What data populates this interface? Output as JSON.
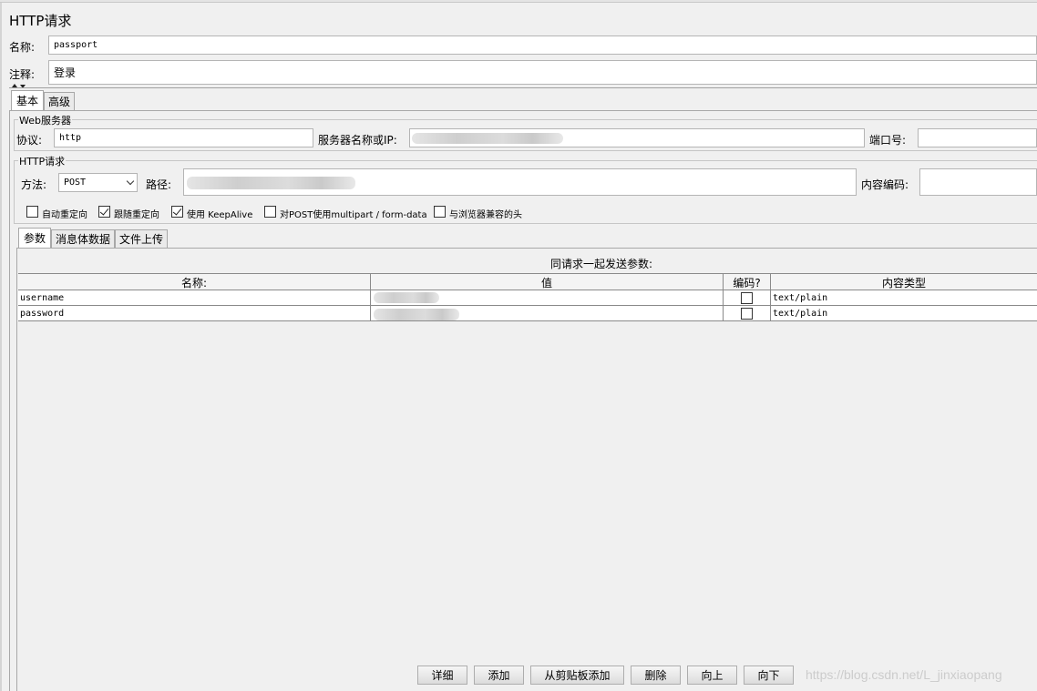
{
  "panel_title": "HTTP请求",
  "name_label": "名称:",
  "name_value": "passport",
  "comment_label": "注释:",
  "comment_value": "登录",
  "main_tabs": [
    {
      "label": "基本",
      "active": true
    },
    {
      "label": "高级",
      "active": false
    }
  ],
  "web_server": {
    "title": "Web服务器",
    "protocol_label": "协议:",
    "protocol_value": "http",
    "server_label": "服务器名称或IP:",
    "port_label": "端口号:"
  },
  "http_request": {
    "title": "HTTP请求",
    "method_label": "方法:",
    "method_value": "POST",
    "path_label": "路径:",
    "encoding_label": "内容编码:",
    "options": [
      {
        "label": "自动重定向",
        "checked": false
      },
      {
        "label": "跟随重定向",
        "checked": true
      },
      {
        "label": "使用 KeepAlive",
        "checked": true
      },
      {
        "label": "对POST使用multipart / form-data",
        "checked": false
      },
      {
        "label": "与浏览器兼容的头",
        "checked": false
      }
    ]
  },
  "param_tabs": [
    {
      "label": "参数",
      "active": true
    },
    {
      "label": "消息体数据",
      "active": false
    },
    {
      "label": "文件上传",
      "active": false
    }
  ],
  "params_caption": "同请求一起发送参数:",
  "table": {
    "headers": [
      "名称:",
      "值",
      "编码?",
      "内容类型"
    ],
    "rows": [
      {
        "name": "username",
        "encode": false,
        "content_type": "text/plain"
      },
      {
        "name": "password",
        "encode": false,
        "content_type": "text/plain"
      }
    ]
  },
  "buttons": [
    "详细",
    "添加",
    "从剪贴板添加",
    "删除",
    "向上",
    "向下"
  ],
  "watermark": "https://blog.csdn.net/L_jinxiaopang",
  "colors": {
    "background": "#f0f0f0",
    "field_border": "#b5b5b5",
    "grid_line": "#8a8a8a"
  }
}
